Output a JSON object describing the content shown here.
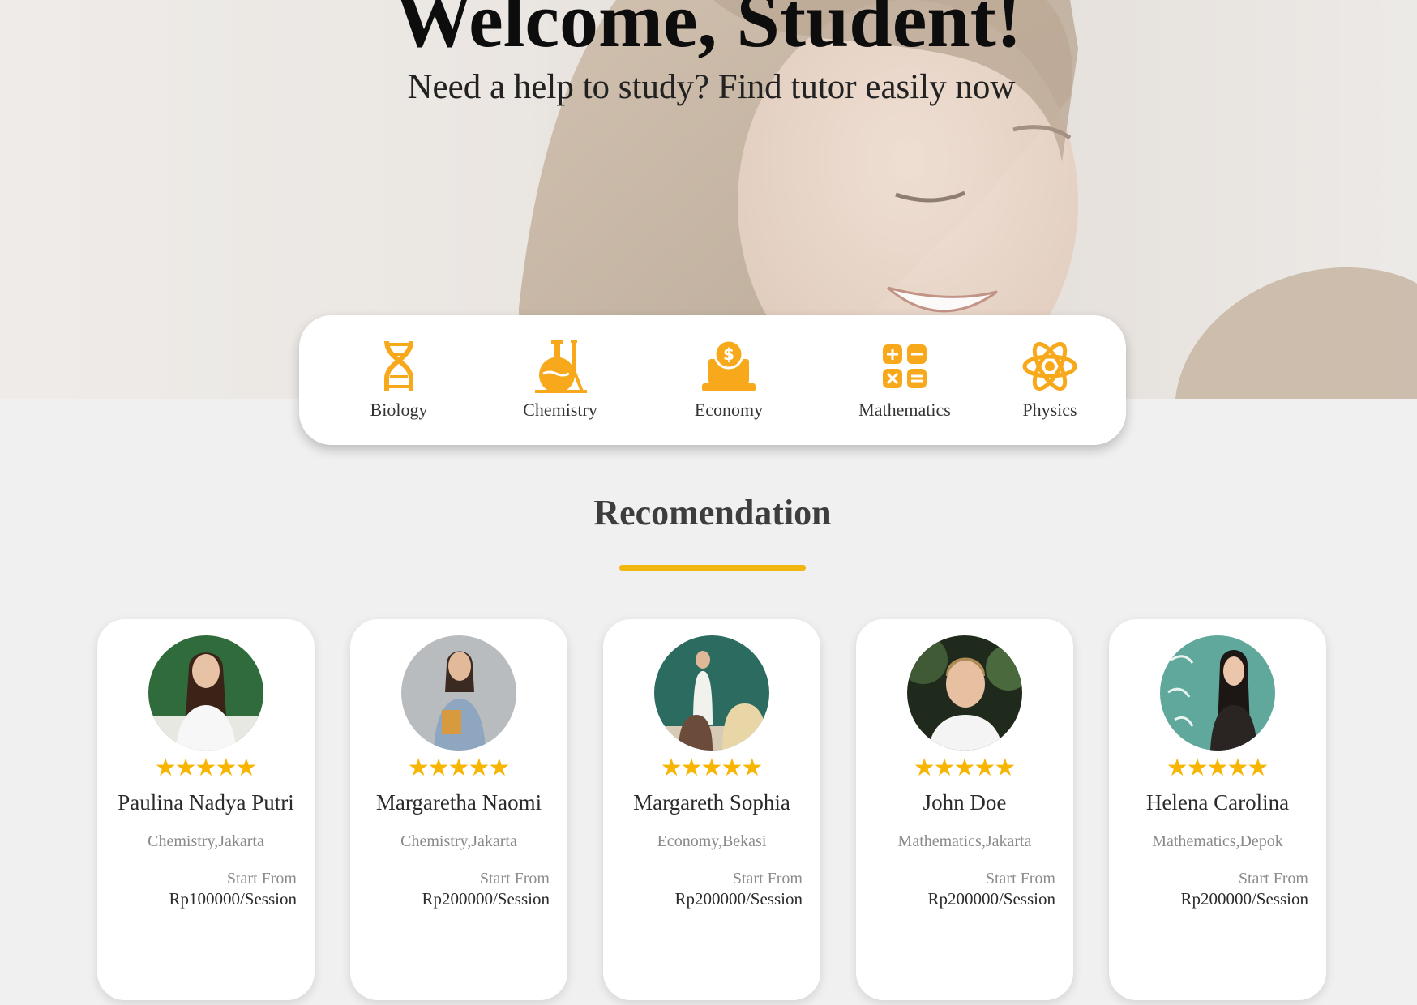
{
  "hero": {
    "title": "Welcome, Student!",
    "subtitle": "Need a help to study? Find tutor easily now"
  },
  "categories": [
    {
      "label": "Biology",
      "icon": "dna-icon"
    },
    {
      "label": "Chemistry",
      "icon": "flask-icon"
    },
    {
      "label": "Economy",
      "icon": "laptop-dollar-icon"
    },
    {
      "label": "Mathematics",
      "icon": "calculator-icon"
    },
    {
      "label": "Physics",
      "icon": "atom-icon"
    }
  ],
  "section": {
    "title": "Recomendation"
  },
  "colors": {
    "accent": "#f7a91b",
    "star": "#f7b500",
    "underline": "#f2b70f"
  },
  "tutors": [
    {
      "name": "Paulina Nadya Putri",
      "meta": "Chemistry,Jakarta",
      "price_label": "Start From",
      "price": "Rp100000/Session",
      "rating": 5
    },
    {
      "name": "Margaretha Naomi",
      "meta": "Chemistry,Jakarta",
      "price_label": "Start From",
      "price": "Rp200000/Session",
      "rating": 5
    },
    {
      "name": "Margareth Sophia",
      "meta": "Economy,Bekasi",
      "price_label": "Start From",
      "price": "Rp200000/Session",
      "rating": 5
    },
    {
      "name": "John Doe",
      "meta": "Mathematics,Jakarta",
      "price_label": "Start From",
      "price": "Rp200000/Session",
      "rating": 5
    },
    {
      "name": "Helena Carolina",
      "meta": "Mathematics,Depok",
      "price_label": "Start From",
      "price": "Rp200000/Session",
      "rating": 5
    }
  ]
}
